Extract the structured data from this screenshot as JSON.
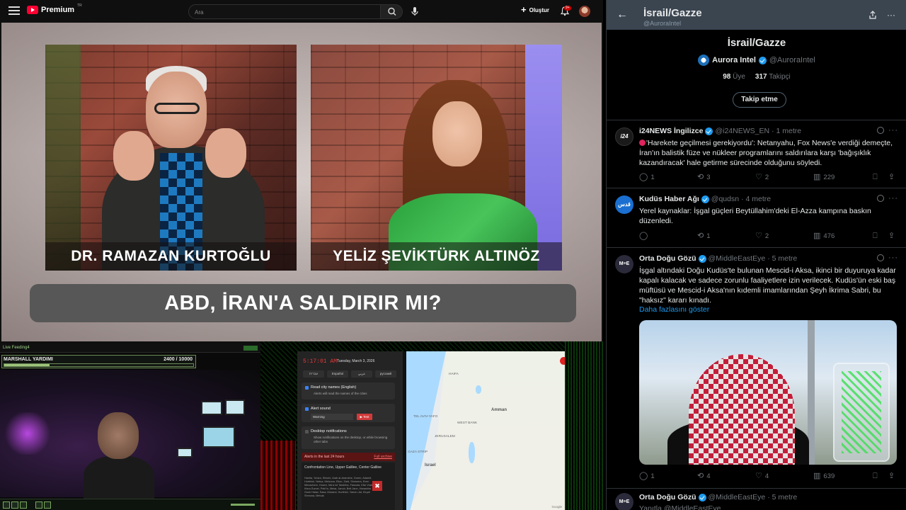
{
  "youtube": {
    "logo_text": "Premium",
    "logo_region": "TR",
    "search_placeholder": "Ara",
    "create_label": "Oluştur",
    "notification_count": "9+"
  },
  "video": {
    "left_name": "DR. RAMAZAN KURTOĞLU",
    "right_name": "YELİZ ŞEVİKTÜRK ALTINÖZ",
    "headline": "ABD, İRAN'A SALDIRIR MI?"
  },
  "stream": {
    "window_title": "Live Feeding4",
    "bar_label": "MARSHALL YARDIMI",
    "bar_value": "2400  /  10000",
    "bar_fraction": 0.24
  },
  "alerts": {
    "time": "5:17:01 AM",
    "date": "Tuesday, March 3, 2026",
    "languages": [
      "עברית",
      "Español",
      "عربي",
      "русский"
    ],
    "read_city_title": "Read city names (English)",
    "read_city_sub": "Alerts will read the names of the cities",
    "alert_sound_title": "Alert sound",
    "alert_sound_value": "Warning",
    "test_label": "▶ Test",
    "desktop_title": "Desktop notifications",
    "desktop_sub": "Show notifications on the desktop, or while browsing other tabs",
    "last_title": "Alerts in the last 24 hours",
    "full_archive": "Full archive",
    "list_title": "Confrontation Line, Upper Galilee, Center Galilee",
    "list_body": "Hanita, Ya'ara, Shlomi, Arab al-Aramshe, Goren, Adamit, Hurfeish, Netua, Metzuva, Eilon, Zarit, Shomera, Even Menachem, Hosen, Ma'a lot Tarshiha, Fassuta, Kfar Vradim, Kisra-Sumei, Peki'in, Meiar, Januh, Beit Jann, Harashim, Gush Halav, Sasa, Mararot, Hurfeish, Yanuh-Jat, Kiryat Shmona, Metula",
    "map_labels": {
      "haifa": "HAIFA",
      "tel_aviv": "TEL AVIV-YAFO",
      "jerusalem": "JERUSALEM",
      "amman": "Amman",
      "west_bank": "WEST BANK",
      "gaza": "GAZA STRIP",
      "israel": "Israel",
      "google": "Google"
    }
  },
  "twitter": {
    "header_title": "İsrail/Gazze",
    "header_handle": "@AuroraIntel",
    "list_title": "İsrail/Gazze",
    "owner_name": "Aurora Intel",
    "owner_handle": "@AuroraIntel",
    "members_count": "98",
    "members_label": "Üye",
    "followers_count": "317",
    "followers_label": "Takipçi",
    "follow_button": "Takip etme",
    "show_more": "Daha fazlasını göster",
    "tweets": [
      {
        "name": "i24NEWS İngilizce",
        "handle": "@i24NEWS_EN",
        "time": "· 1 metre",
        "text": "'Harekete geçilmesi gerekiyordu': Netanyahu, Fox News'e verdiği demeçte, İran'ın balistik füze ve nükleer programlarını saldırılara karşı 'bağışıklık kazandıracak' hale getirme sürecinde olduğunu söyledi.",
        "replies": "1",
        "reposts": "3",
        "likes": "2",
        "views": "229",
        "avatar_label": "i24"
      },
      {
        "name": "Kudüs Haber Ağı",
        "handle": "@qudsn",
        "time": "· 4 metre",
        "text": "Yerel kaynaklar: İşgal güçleri Beytüllahim'deki El-Azza kampına baskın düzenledi.",
        "replies": "",
        "reposts": "1",
        "likes": "2",
        "views": "476",
        "avatar_label": "قدس"
      },
      {
        "name": "Orta Doğu Gözü",
        "handle": "@MiddleEastEye",
        "time": "· 5 metre",
        "text": "İşgal altındaki Doğu Kudüs'te bulunan Mescid-i Aksa, ikinci bir duyuruya kadar kapalı kalacak ve sadece zorunlu faaliyetlere izin verilecek. Kudüs'ün eski baş müftüsü ve Mescid-i Aksa'nın kıdemli imamlarından Şeyh İkrima Sabri, bu \"haksız\" kararı kınadı.",
        "replies": "1",
        "reposts": "4",
        "likes": "4",
        "views": "639",
        "avatar_label": "M≡E"
      },
      {
        "name": "Orta Doğu Gözü",
        "handle": "@MiddleEastEye",
        "time": "· 5 metre",
        "text": "Yanıtla @MiddleEastEye",
        "avatar_label": "M≡E"
      }
    ]
  },
  "colors": {
    "x_accent": "#1d9bf0",
    "yt_red": "#ff0033",
    "alert_red": "#e23a3a"
  }
}
